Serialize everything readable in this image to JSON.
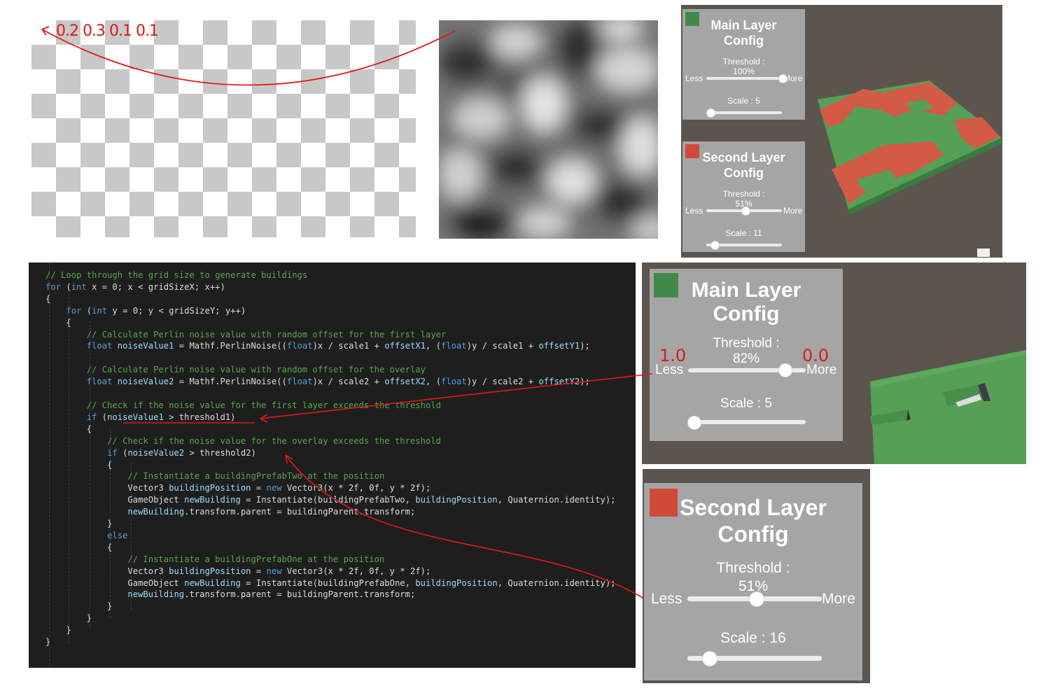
{
  "checkerboard": {
    "annotation_values": "0.2 0.3 0.1 0.1"
  },
  "main_layer_small": {
    "title": "Main Layer Config",
    "threshold_label": "Threshold :",
    "threshold_value": "100%",
    "threshold_fraction": 1.0,
    "less_label": "Less",
    "more_label": "More",
    "scale_label": "Scale : 5",
    "scale_fraction": 0.05,
    "swatch_color": "#3f8a4a"
  },
  "second_layer_small": {
    "title": "Second Layer Config",
    "threshold_label": "Threshold :",
    "threshold_value": "51%",
    "threshold_fraction": 0.51,
    "less_label": "Less",
    "more_label": "More",
    "scale_label": "Scale : 11",
    "scale_fraction": 0.11,
    "swatch_color": "#d04a3a"
  },
  "main_layer_big": {
    "title": "Main Layer Config",
    "threshold_label": "Threshold :",
    "threshold_value": "82%",
    "threshold_fraction": 0.82,
    "less_label": "Less",
    "more_label": "More",
    "scale_label": "Scale : 5",
    "scale_fraction": 0.05,
    "annotation_less": "1.0",
    "annotation_more": "0.0",
    "swatch_color": "#3f8a4a"
  },
  "second_layer_big": {
    "title": "Second Layer Config",
    "threshold_label": "Threshold :",
    "threshold_value": "51%",
    "threshold_fraction": 0.51,
    "less_label": "Less",
    "more_label": "More",
    "scale_label": "Scale : 16",
    "scale_fraction": 0.16,
    "swatch_color": "#d04a3a"
  },
  "code": {
    "lines": [
      "// Loop through the grid size to generate buildings",
      "for (int x = 0; x < gridSizeX; x++)",
      "{",
      "    for (int y = 0; y < gridSizeY; y++)",
      "    {",
      "        // Calculate Perlin noise value with random offset for the first layer",
      "        float noiseValue1 = Mathf.PerlinNoise((float)x / scale1 + offsetX1, (float)y / scale1 + offsetY1);",
      "",
      "        // Calculate Perlin noise value with random offset for the overlay",
      "        float noiseValue2 = Mathf.PerlinNoise((float)x / scale2 + offsetX2, (float)y / scale2 + offsetY2);",
      "",
      "        // Check if the noise value for the first layer exceeds the threshold",
      "        if (noiseValue1 > threshold1)",
      "        {",
      "            // Check if the noise value for the overlay exceeds the threshold",
      "            if (noiseValue2 > threshold2)",
      "            {",
      "                // Instantiate a buildingPrefabTwo at the position",
      "                Vector3 buildingPosition = new Vector3(x * 2f, 0f, y * 2f);",
      "                GameObject newBuilding = Instantiate(buildingPrefabTwo, buildingPosition, Quaternion.identity);",
      "                newBuilding.transform.parent = buildingParent.transform;",
      "            }",
      "            else",
      "            {",
      "                // Instantiate a buildingPrefabOne at the position",
      "                Vector3 buildingPosition = new Vector3(x * 2f, 0f, y * 2f);",
      "                GameObject newBuilding = Instantiate(buildingPrefabOne, buildingPosition, Quaternion.identity);",
      "                newBuilding.transform.parent = buildingParent.transform;",
      "            }",
      "        }",
      "    }",
      "}"
    ]
  },
  "colors": {
    "annotation_red": "#e01818",
    "panel_gray": "#a5a5a5",
    "scene_bg": "#5b544f",
    "ground_green": "#4f9a52",
    "overlay_red": "#d0553f"
  }
}
